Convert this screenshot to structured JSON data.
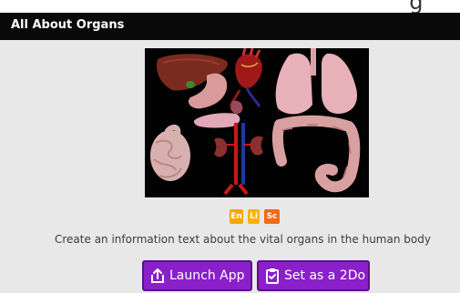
{
  "header": {
    "title": "All About Organs"
  },
  "image": {
    "subject": "human-organs-illustration"
  },
  "badges": [
    {
      "label": "En",
      "color": "#f5a700"
    },
    {
      "label": "Li",
      "color": "#f5b400"
    },
    {
      "label": "Sc",
      "color": "#ef6a1e"
    }
  ],
  "description": "Create an information text about the vital organs in the human body",
  "buttons": {
    "launch_label": "Launch App",
    "launch_icon": "share-upload-icon",
    "todo_label": "Set as a 2Do",
    "todo_icon": "clipboard-check-icon"
  },
  "colors": {
    "header_bg": "#0a0a0a",
    "button_bg": "#8b1fc9",
    "page_bg": "#e8e8e8"
  }
}
